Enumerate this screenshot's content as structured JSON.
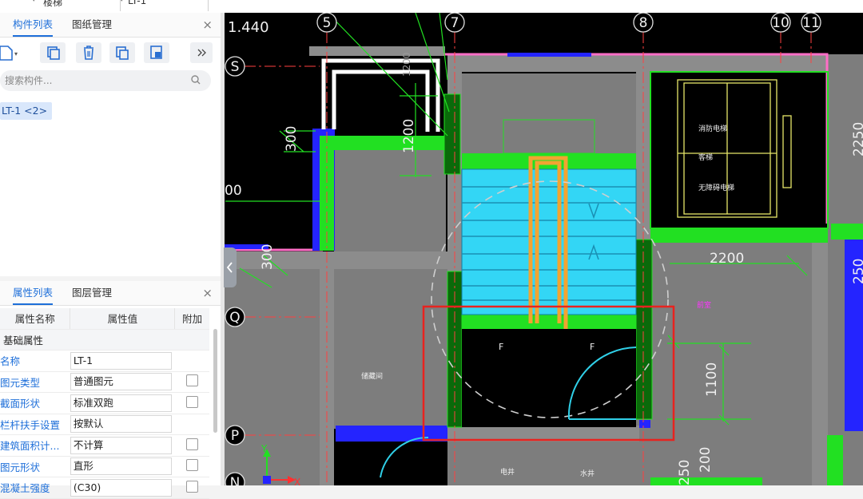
{
  "topbar": {
    "combo1": "楼梯",
    "combo2": "LT-1"
  },
  "component_panel": {
    "tabs": [
      "构件列表",
      "图纸管理"
    ],
    "close": "×",
    "search_placeholder": "搜索构件...",
    "selected_item": "LT-1 <2>"
  },
  "property_panel": {
    "tabs": [
      "属性列表",
      "图层管理"
    ],
    "close": "×",
    "headers": [
      "属性名称",
      "属性值",
      "附加"
    ],
    "group": "基础属性",
    "rows": [
      {
        "name": "名称",
        "value": "LT-1",
        "checkbox": false
      },
      {
        "name": "图元类型",
        "value": "普通图元",
        "checkbox": true
      },
      {
        "name": "截面形状",
        "value": "标准双跑",
        "checkbox": true
      },
      {
        "name": "栏杆扶手设置",
        "value": "按默认",
        "checkbox": false
      },
      {
        "name": "建筑面积计...",
        "value": "不计算",
        "checkbox": true
      },
      {
        "name": "图元形状",
        "value": "直形",
        "checkbox": true
      },
      {
        "name": "混凝土强度",
        "value": "(C30)",
        "checkbox": true
      }
    ]
  },
  "cad": {
    "elevation": "1.440",
    "axis_top": [
      "5",
      "7",
      "8",
      "10",
      "11"
    ],
    "axis_left": [
      "S",
      "Q",
      "P",
      "N"
    ],
    "dims": [
      "300",
      "1200",
      "300",
      "2200",
      "1100",
      "200",
      "250",
      "2250",
      "00",
      "250",
      "1200"
    ],
    "room_labels": [
      "消防电梯",
      "客梯",
      "无障碍电梯",
      "储藏间",
      "前室",
      "电井",
      "水井"
    ],
    "step_marks": [
      "F",
      "F"
    ],
    "ucs": {
      "x": "X",
      "y": "Y"
    }
  },
  "colors": {
    "accent": "#1e6fd9",
    "highlight_box": "#e8231f",
    "stair_fill": "#33d6f5",
    "railing": "#f2a431"
  }
}
